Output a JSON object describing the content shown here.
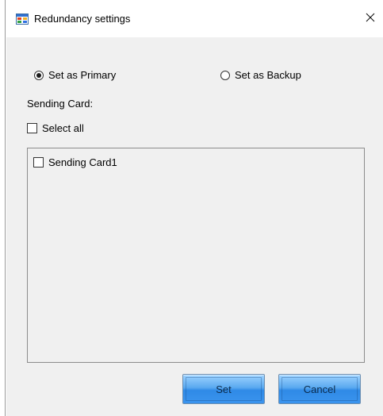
{
  "window": {
    "title": "Redundancy settings",
    "icon": "app-window-icon",
    "close_glyph": "✕"
  },
  "mode": {
    "options": [
      {
        "label": "Set as Primary",
        "selected": true
      },
      {
        "label": "Set as Backup",
        "selected": false
      }
    ]
  },
  "sending_card": {
    "section_label": "Sending Card:",
    "select_all_label": "Select all",
    "select_all_checked": false,
    "items": [
      {
        "label": "Sending Card1",
        "checked": false
      }
    ]
  },
  "buttons": {
    "set_label": "Set",
    "cancel_label": "Cancel"
  },
  "colors": {
    "client_background": "#f0f0f0",
    "button_blue": "#3b94ee"
  }
}
